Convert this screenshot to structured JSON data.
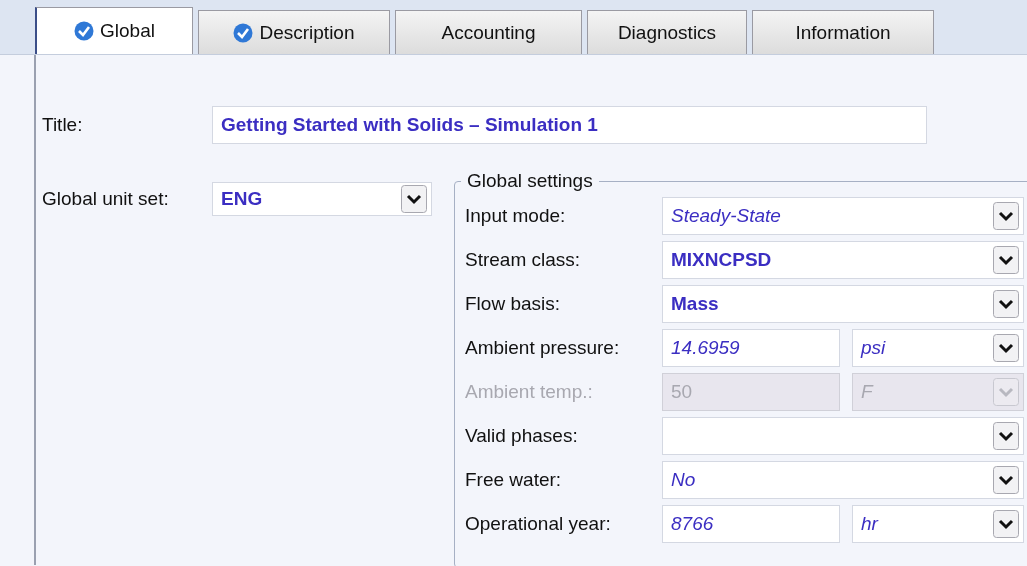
{
  "tabs": [
    {
      "label": "Global",
      "selected": true,
      "complete": true
    },
    {
      "label": "Description",
      "selected": false,
      "complete": true
    },
    {
      "label": "Accounting",
      "selected": false,
      "complete": false
    },
    {
      "label": "Diagnostics",
      "selected": false,
      "complete": false
    },
    {
      "label": "Information",
      "selected": false,
      "complete": false
    }
  ],
  "title": {
    "label": "Title:",
    "value": "Getting Started with Solids – Simulation 1"
  },
  "unit_set": {
    "label": "Global unit set:",
    "value": "ENG",
    "bold": true,
    "italic": false
  },
  "global_settings": {
    "title": "Global settings",
    "rows": [
      {
        "kind": "dropdown",
        "label": "Input mode:",
        "value": "Steady-State",
        "bold": false,
        "italic": true,
        "disabled": false
      },
      {
        "kind": "dropdown",
        "label": "Stream class:",
        "value": "MIXNCPSD",
        "bold": true,
        "italic": false,
        "disabled": false
      },
      {
        "kind": "dropdown",
        "label": "Flow basis:",
        "value": "Mass",
        "bold": true,
        "italic": false,
        "disabled": false
      },
      {
        "kind": "value-unit",
        "label": "Ambient pressure:",
        "value": "14.6959",
        "unit": "psi",
        "bold": false,
        "italic": true,
        "disabled": false
      },
      {
        "kind": "value-unit",
        "label": "Ambient temp.:",
        "value": "50",
        "unit": "F",
        "bold": false,
        "italic": true,
        "disabled": true
      },
      {
        "kind": "dropdown",
        "label": "Valid phases:",
        "disabled": false
      },
      {
        "kind": "dropdown",
        "label": "Free water:",
        "value": "No",
        "bold": false,
        "italic": true,
        "disabled": false
      },
      {
        "kind": "value-unit",
        "label": "Operational year:",
        "value": "8766",
        "unit": "hr",
        "bold": false,
        "italic": true,
        "disabled": false
      }
    ]
  }
}
